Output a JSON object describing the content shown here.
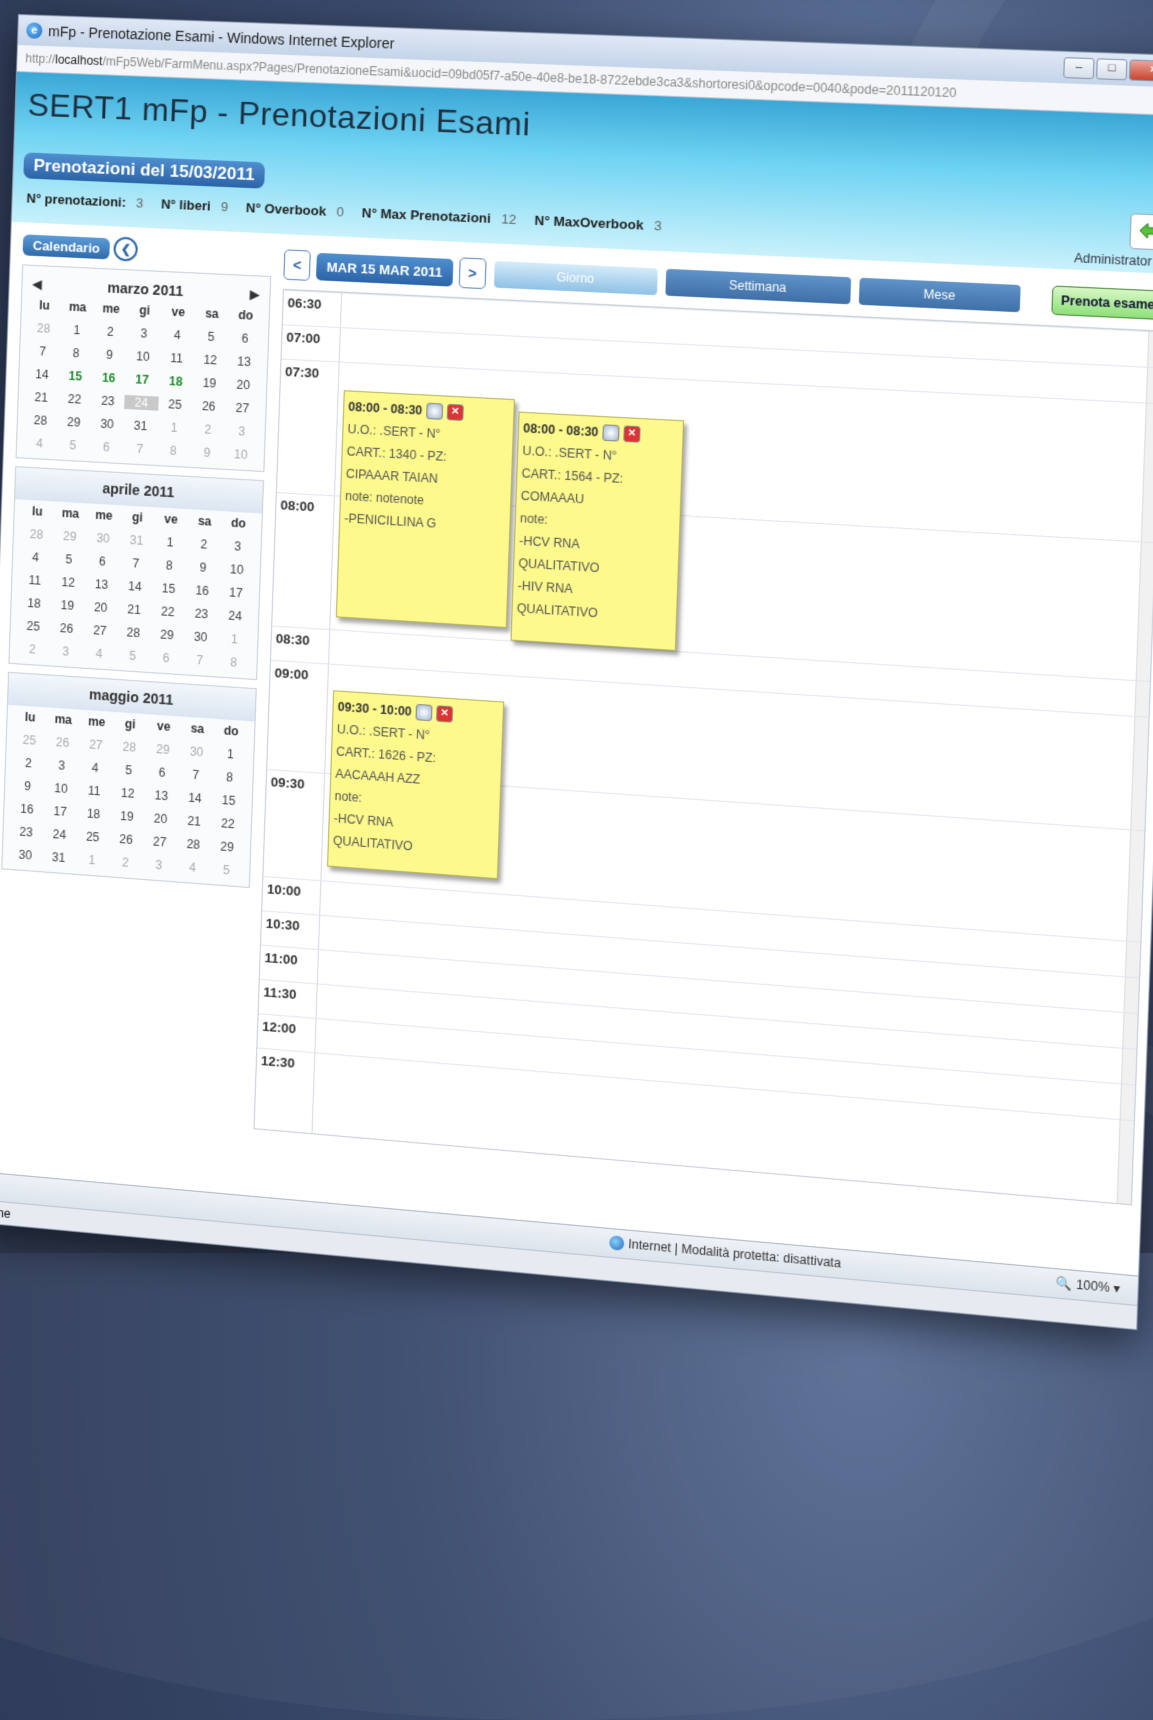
{
  "window": {
    "title": "mFp - Prenotazione Esami - Windows Internet Explorer"
  },
  "address": {
    "prefix": "http://",
    "host": "localhost",
    "path": "/mFp5Web/FarmMenu.aspx?Pages/PrenotazioneEsami&uocid=09bd05f7-a50e-40e8-be18-8722ebde3ca3&shortoresi0&opcode=0040&pode=2011120120"
  },
  "header": {
    "app_title": "SERT1 mFp - Prenotazioni Esami",
    "booking_title": "Prenotazioni del 15/03/2011",
    "user": "Administrator -",
    "stats": [
      {
        "label": "N° prenotazioni:",
        "value": "3"
      },
      {
        "label": "N° liberi",
        "value": "9"
      },
      {
        "label": "N° Overbook",
        "value": "0"
      },
      {
        "label": "N° Max Prenotazioni",
        "value": "12"
      },
      {
        "label": "N° MaxOverbook",
        "value": "3"
      }
    ]
  },
  "calendar": {
    "label": "Calendario",
    "prev": "◀",
    "next": "▶",
    "dow": [
      "lu",
      "ma",
      "me",
      "gi",
      "ve",
      "sa",
      "do"
    ],
    "months": [
      {
        "name": "marzo 2011",
        "days": [
          [
            "28",
            "o"
          ],
          [
            "1",
            ""
          ],
          [
            "2",
            ""
          ],
          [
            "3",
            ""
          ],
          [
            "4",
            ""
          ],
          [
            "5",
            ""
          ],
          [
            "6",
            ""
          ],
          [
            "7",
            ""
          ],
          [
            "8",
            ""
          ],
          [
            "9",
            ""
          ],
          [
            "10",
            ""
          ],
          [
            "11",
            ""
          ],
          [
            "12",
            ""
          ],
          [
            "13",
            ""
          ],
          [
            "14",
            ""
          ],
          [
            "15",
            "g"
          ],
          [
            "16",
            "g"
          ],
          [
            "17",
            "g"
          ],
          [
            "18",
            "g"
          ],
          [
            "19",
            ""
          ],
          [
            "20",
            ""
          ],
          [
            "21",
            ""
          ],
          [
            "22",
            ""
          ],
          [
            "23",
            ""
          ],
          [
            "24",
            "t"
          ],
          [
            "25",
            ""
          ],
          [
            "26",
            ""
          ],
          [
            "27",
            ""
          ],
          [
            "28",
            ""
          ],
          [
            "29",
            ""
          ],
          [
            "30",
            ""
          ],
          [
            "31",
            ""
          ],
          [
            "1",
            "o"
          ],
          [
            "2",
            "o"
          ],
          [
            "3",
            "o"
          ],
          [
            "4",
            "o"
          ],
          [
            "5",
            "o"
          ],
          [
            "6",
            "o"
          ],
          [
            "7",
            "o"
          ],
          [
            "8",
            "o"
          ],
          [
            "9",
            "o"
          ],
          [
            "10",
            "o"
          ]
        ]
      },
      {
        "name": "aprile 2011",
        "days": [
          [
            "28",
            "o"
          ],
          [
            "29",
            "o"
          ],
          [
            "30",
            "o"
          ],
          [
            "31",
            "o"
          ],
          [
            "1",
            ""
          ],
          [
            "2",
            ""
          ],
          [
            "3",
            ""
          ],
          [
            "4",
            ""
          ],
          [
            "5",
            ""
          ],
          [
            "6",
            ""
          ],
          [
            "7",
            ""
          ],
          [
            "8",
            ""
          ],
          [
            "9",
            ""
          ],
          [
            "10",
            ""
          ],
          [
            "11",
            ""
          ],
          [
            "12",
            ""
          ],
          [
            "13",
            ""
          ],
          [
            "14",
            ""
          ],
          [
            "15",
            ""
          ],
          [
            "16",
            ""
          ],
          [
            "17",
            ""
          ],
          [
            "18",
            ""
          ],
          [
            "19",
            ""
          ],
          [
            "20",
            ""
          ],
          [
            "21",
            ""
          ],
          [
            "22",
            ""
          ],
          [
            "23",
            ""
          ],
          [
            "24",
            ""
          ],
          [
            "25",
            ""
          ],
          [
            "26",
            ""
          ],
          [
            "27",
            ""
          ],
          [
            "28",
            ""
          ],
          [
            "29",
            ""
          ],
          [
            "30",
            ""
          ],
          [
            "1",
            "o"
          ],
          [
            "2",
            "o"
          ],
          [
            "3",
            "o"
          ],
          [
            "4",
            "o"
          ],
          [
            "5",
            "o"
          ],
          [
            "6",
            "o"
          ],
          [
            "7",
            "o"
          ],
          [
            "8",
            "o"
          ]
        ]
      },
      {
        "name": "maggio 2011",
        "days": [
          [
            "25",
            "o"
          ],
          [
            "26",
            "o"
          ],
          [
            "27",
            "o"
          ],
          [
            "28",
            "o"
          ],
          [
            "29",
            "o"
          ],
          [
            "30",
            "o"
          ],
          [
            "1",
            ""
          ],
          [
            "2",
            ""
          ],
          [
            "3",
            ""
          ],
          [
            "4",
            ""
          ],
          [
            "5",
            ""
          ],
          [
            "6",
            ""
          ],
          [
            "7",
            ""
          ],
          [
            "8",
            ""
          ],
          [
            "9",
            ""
          ],
          [
            "10",
            ""
          ],
          [
            "11",
            ""
          ],
          [
            "12",
            ""
          ],
          [
            "13",
            ""
          ],
          [
            "14",
            ""
          ],
          [
            "15",
            ""
          ],
          [
            "16",
            ""
          ],
          [
            "17",
            ""
          ],
          [
            "18",
            ""
          ],
          [
            "19",
            ""
          ],
          [
            "20",
            ""
          ],
          [
            "21",
            ""
          ],
          [
            "22",
            ""
          ],
          [
            "23",
            ""
          ],
          [
            "24",
            ""
          ],
          [
            "25",
            ""
          ],
          [
            "26",
            ""
          ],
          [
            "27",
            ""
          ],
          [
            "28",
            ""
          ],
          [
            "29",
            ""
          ],
          [
            "30",
            ""
          ],
          [
            "31",
            ""
          ],
          [
            "1",
            "o"
          ],
          [
            "2",
            "o"
          ],
          [
            "3",
            "o"
          ],
          [
            "4",
            "o"
          ],
          [
            "5",
            "o"
          ]
        ]
      }
    ]
  },
  "scheduler": {
    "prev": "<",
    "next": ">",
    "date_label": "MAR 15 MAR 2011",
    "views": [
      "Giorno",
      "Settimana",
      "Mese"
    ],
    "active_view": "Giorno",
    "book_button": "Prenota esame",
    "slots": [
      "06:30",
      "07:00",
      "07:30",
      "08:00",
      "08:30",
      "09:00",
      "09:30",
      "10:00",
      "10:30",
      "11:00",
      "11:30",
      "12:00",
      "12:30"
    ],
    "appointments": [
      {
        "time": "08:00 - 08:30",
        "lines": [
          "U.O.: .SERT - N°",
          "CART.: 1340  - PZ:",
          "CIPAAAR TAIAN",
          "note: notenote",
          "-PENICILLINA G"
        ]
      },
      {
        "time": "08:00 - 08:30",
        "lines": [
          "U.O.: .SERT - N°",
          "CART.: 1564  - PZ:",
          "COMAAAU",
          "note:",
          "-HCV RNA",
          "QUALITATIVO",
          "-HIV RNA",
          "QUALITATIVO"
        ]
      },
      {
        "time": "09:30 - 10:00",
        "lines": [
          "U.O.: .SERT - N°",
          "CART.: 1626  - PZ:",
          "AACAAAH AZZ",
          "note:",
          "-HCV RNA",
          "QUALITATIVO"
        ]
      }
    ]
  },
  "status": {
    "zone": "Internet | Modalità protetta: disattivata",
    "zoom": "100%",
    "fine": "Fine"
  }
}
